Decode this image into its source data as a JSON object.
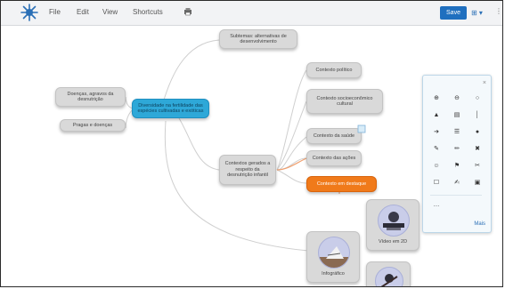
{
  "toolbar": {
    "menu": [
      "File",
      "Edit",
      "View",
      "Shortcuts"
    ],
    "save_label": "Save",
    "view_label": "⊞ ▾",
    "more_label": "⋮"
  },
  "mindmap": {
    "root": "Diversidade na fertilidade das espécies cultivadas e exóticas",
    "left": [
      "Doenças, agravos da desnutrição",
      "Pragas e doenças"
    ],
    "top": "Subtemas: alternativas de desenvolvimento",
    "center": "Contextos gerados a respeito da desnutrição infantil",
    "right": [
      "Contexto político",
      "Contexto socioeconômico cultural",
      "Contexto da saúde",
      "Contexto das ações",
      "Contexto em destaque"
    ],
    "images": [
      {
        "caption": "Infográfico"
      },
      {
        "caption": "Vídeo em 2D"
      },
      {
        "caption": ""
      }
    ]
  },
  "palette": {
    "close": "×",
    "more": "Mais",
    "tools": [
      [
        "⊕",
        "⊖",
        "○"
      ],
      [
        "▲",
        "▤",
        "│"
      ],
      [
        "➔",
        "☰",
        "●"
      ],
      [
        "✎",
        "✏",
        "✖"
      ],
      [
        "☺",
        "⚑",
        "✂"
      ],
      [
        "☐",
        "✍",
        "▣"
      ],
      [
        "…",
        "",
        ""
      ]
    ]
  }
}
